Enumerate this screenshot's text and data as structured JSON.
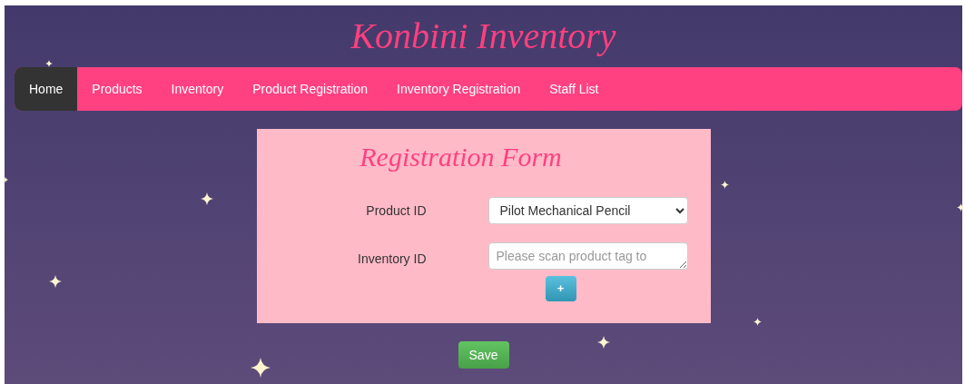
{
  "site_title": "Konbini Inventory",
  "nav": [
    {
      "label": "Home",
      "selected": true
    },
    {
      "label": "Products",
      "selected": false
    },
    {
      "label": "Inventory",
      "selected": false
    },
    {
      "label": "Product Registration",
      "selected": false
    },
    {
      "label": "Inventory Registration",
      "selected": false
    },
    {
      "label": "Staff List",
      "selected": false
    }
  ],
  "form": {
    "title": "Registration Form",
    "fields": [
      {
        "kind": "select",
        "label": "Product ID",
        "value": "Pilot Mechanical Pencil"
      },
      {
        "kind": "textarea",
        "label": "Inventory ID",
        "placeholder": "Please scan product tag to"
      }
    ],
    "add_button": "+"
  },
  "save_button": "Save"
}
